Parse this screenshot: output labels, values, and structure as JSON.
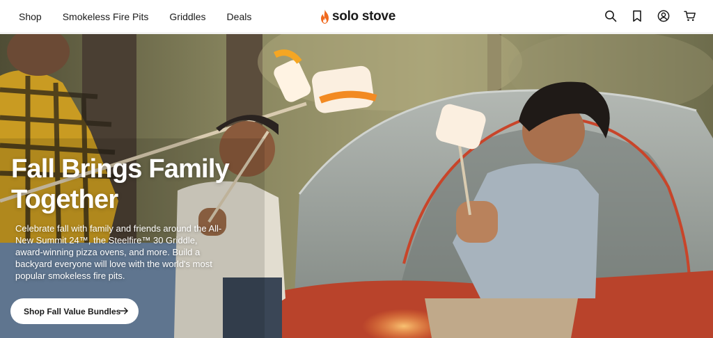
{
  "header": {
    "nav": [
      {
        "label": "Shop"
      },
      {
        "label": "Smokeless Fire Pits"
      },
      {
        "label": "Griddles"
      },
      {
        "label": "Deals"
      }
    ],
    "logo_text": "solo stove",
    "icons": [
      "search-icon",
      "bookmark-icon",
      "account-icon",
      "cart-icon"
    ]
  },
  "hero": {
    "title": "Fall Brings Family Together",
    "subtitle": "Celebrate fall with family and friends around the All-New Summit 24™, the Steelfire™ 30 Griddle, award-winning pizza ovens, and more. Build a backyard everyone will love with the world's most popular smokeless fire pits.",
    "cta_label": "Shop Fall Value Bundles"
  },
  "colors": {
    "brand_flame": "#f06a1f",
    "text": "#1a1a1a",
    "tent": "#9aa09c",
    "tent_trim": "#c8452a"
  }
}
